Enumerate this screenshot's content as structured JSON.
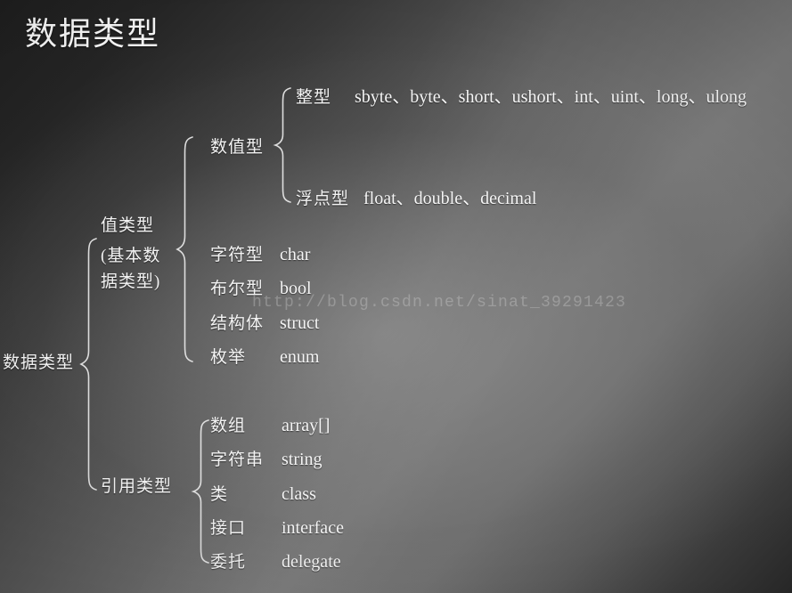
{
  "slide": {
    "title": "数据类型",
    "watermark": "http://blog.csdn.net/sinat_39291423",
    "background": {
      "dark": "#1f1f1f",
      "mid": "#545454",
      "light": "#7b7b7b",
      "text": "#f3f3f3"
    }
  },
  "tree": {
    "root": {
      "label": "数据类型"
    },
    "value_type": {
      "label_line1": "值类型",
      "label_line2": "(基本数",
      "label_line3": "据类型)",
      "numeric": {
        "label": "数值型",
        "children": [
          {
            "label": "整型",
            "value": "sbyte、byte、short、ushort、int、uint、long、ulong"
          },
          {
            "label": "浮点型",
            "value": "float、double、decimal"
          }
        ]
      },
      "others": [
        {
          "label": "字符型",
          "value": "char"
        },
        {
          "label": "布尔型",
          "value": "bool"
        },
        {
          "label": "结构体",
          "value": "struct"
        },
        {
          "label": "枚举",
          "value": "enum"
        }
      ]
    },
    "reference_type": {
      "label": "引用类型",
      "children": [
        {
          "label": "数组",
          "value": "array[]"
        },
        {
          "label": "字符串",
          "value": "string"
        },
        {
          "label": "类",
          "value": "class"
        },
        {
          "label": "接口",
          "value": "interface"
        },
        {
          "label": "委托",
          "value": "delegate"
        }
      ]
    }
  }
}
